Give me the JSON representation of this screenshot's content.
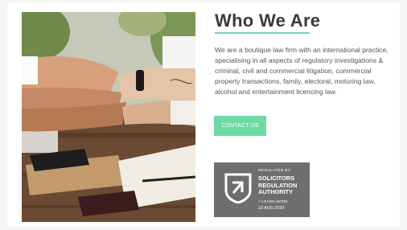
{
  "section": {
    "title": "Who We Are",
    "body": "We are a boutique law firm with an international practice, specialising in all aspects of regulatory investigations & criminal, civil and commercial litigation, commercial property transactions, family, electoral, motoring law, alcohol and entertainment licencing law.",
    "cta_label": "CONTACT US"
  },
  "badge": {
    "regulated_by": "REGULATED BY",
    "organisation": "SOLICITORS\nREGULATION\nAUTHORITY",
    "learn_more": "> LEARN MORE",
    "date": "23 AUG 2020"
  },
  "colors": {
    "accent": "#6ed9a5",
    "title": "#3a3a3a",
    "badge_bg": "#6e6e6e"
  }
}
